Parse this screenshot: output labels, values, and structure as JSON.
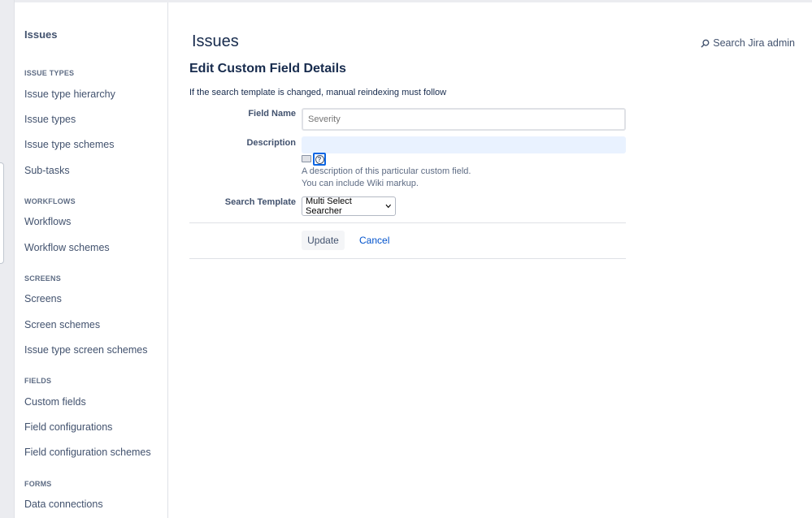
{
  "sidebar": {
    "title": "Issues",
    "sections": [
      {
        "heading": "ISSUE TYPES",
        "items": [
          "Issue type hierarchy",
          "Issue types",
          "Issue type schemes",
          "Sub-tasks"
        ]
      },
      {
        "heading": "WORKFLOWS",
        "items": [
          "Workflows",
          "Workflow schemes"
        ]
      },
      {
        "heading": "SCREENS",
        "items": [
          "Screens",
          "Screen schemes",
          "Issue type screen schemes"
        ]
      },
      {
        "heading": "FIELDS",
        "items": [
          "Custom fields",
          "Field configurations",
          "Field configuration schemes"
        ]
      },
      {
        "heading": "FORMS",
        "items": [
          "Data connections"
        ]
      }
    ]
  },
  "header": {
    "title": "Issues",
    "search_link": "Search Jira admin",
    "search_icon": "search-icon"
  },
  "form": {
    "title": "Edit Custom Field Details",
    "notice": "If the search template is changed, manual reindexing must follow",
    "field_name_label": "Field Name",
    "field_name_placeholder": "Severity",
    "description_label": "Description",
    "description_value": "",
    "description_hint_1": "A description of this particular custom field.",
    "description_hint_2": "You can include Wiki markup.",
    "search_template_label": "Search Template",
    "search_template_value": "Multi Select Searcher",
    "update_label": "Update",
    "cancel_label": "Cancel"
  },
  "colors": {
    "accent": "#0052cc",
    "text": "#172b4d",
    "focus": "#0c66e4",
    "description_bg": "#e9f2ff"
  }
}
